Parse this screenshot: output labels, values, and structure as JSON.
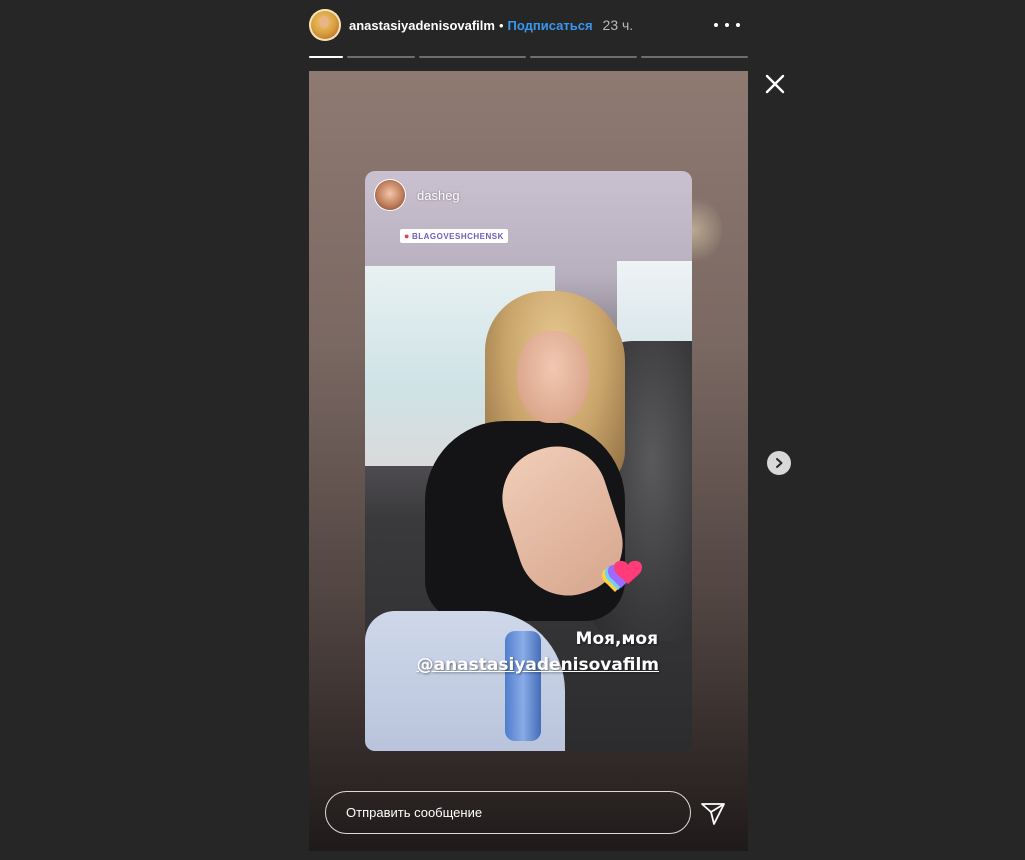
{
  "header": {
    "username": "anastasiyadenisovafilm",
    "separator": "•",
    "follow_label": "Подписаться",
    "time_ago": "23 ч.",
    "more_icon": "more-dots-icon"
  },
  "progress": {
    "segments": 5,
    "current_index": 0,
    "current_fill": 1.0
  },
  "story": {
    "reshared_username": "dasheg",
    "location_sticker": "BLAGOVESHCHENSK",
    "caption_line1": "Моя,моя",
    "caption_line2": "@anastasiyadenisovafilm"
  },
  "reply": {
    "placeholder": "Отправить сообщение",
    "send_icon": "send-paper-plane-icon"
  },
  "controls": {
    "close_icon": "close-icon",
    "next_icon": "chevron-right-icon"
  }
}
